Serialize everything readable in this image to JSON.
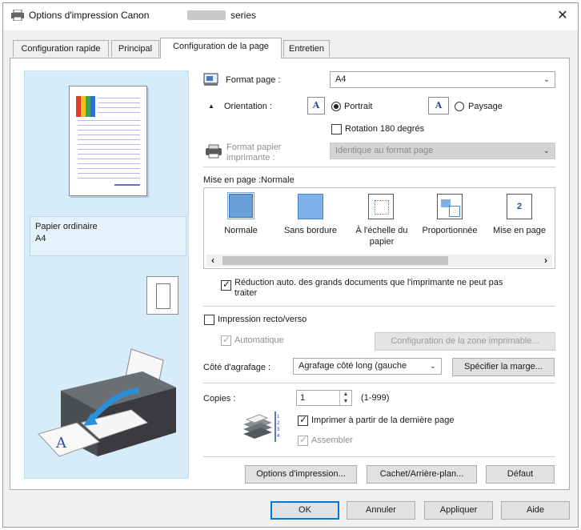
{
  "window": {
    "title": "Options d'impression Canon",
    "title_suffix": "series",
    "close": "✕"
  },
  "tabs": [
    {
      "label": "Configuration rapide"
    },
    {
      "label": "Principal"
    },
    {
      "label": "Configuration de la page",
      "active": true
    },
    {
      "label": "Entretien"
    }
  ],
  "preview": {
    "media": "Papier ordinaire",
    "size": "A4"
  },
  "page_setup": {
    "format_label": "Format page :",
    "format_value": "A4",
    "orientation_label": "Orientation :",
    "portrait_label": "Portrait",
    "landscape_label": "Paysage",
    "orientation_selected": "Portrait",
    "rotate_label": "Rotation 180 degrés",
    "rotate_checked": false,
    "printer_paper_label_1": "Format papier",
    "printer_paper_label_2": "imprimante :",
    "printer_paper_value": "Identique au format page"
  },
  "layout": {
    "heading": "Mise en page :Normale",
    "options": [
      {
        "label": "Normale",
        "icon": "normal-layout-icon"
      },
      {
        "label": "Sans bordure",
        "icon": "borderless-layout-icon"
      },
      {
        "label": "À l'échelle du",
        "label2": "papier",
        "icon": "fit-to-page-icon"
      },
      {
        "label": "Proportionnée",
        "icon": "scaled-layout-icon"
      },
      {
        "label": "Mise en page",
        "icon": "page-layout-icon",
        "badge": "2"
      }
    ],
    "scroll_left": "‹",
    "scroll_right": "›"
  },
  "auto_reduce": {
    "label": "Réduction auto. des grands documents que l'imprimante ne peut pas",
    "label2": "traiter",
    "checked": true
  },
  "duplex": {
    "label": "Impression recto/verso",
    "checked": false,
    "auto_label": "Automatique",
    "auto_checked": true,
    "print_area_button": "Configuration de la zone imprimable...",
    "stapling_label": "Côté d'agrafage :",
    "stapling_value": "Agrafage côté long (gauche",
    "margin_button": "Spécifier la marge..."
  },
  "copies": {
    "label": "Copies :",
    "value": "1",
    "range": "(1-999)",
    "last_page_label": "Imprimer à partir de la dernière page",
    "last_page_checked": true,
    "collate_label": "Assembler",
    "collate_checked": true
  },
  "bottom_buttons": {
    "print_options": "Options d'impression...",
    "stamp": "Cachet/Arrière-plan...",
    "defaults": "Défaut"
  },
  "dialog_buttons": {
    "ok": "OK",
    "cancel": "Annuler",
    "apply": "Appliquer",
    "help": "Aide"
  },
  "colors": {
    "preview_bg": "#d6ecfa",
    "accent": "#0078d7",
    "layout_icon_blue": "#6a9fd8"
  }
}
